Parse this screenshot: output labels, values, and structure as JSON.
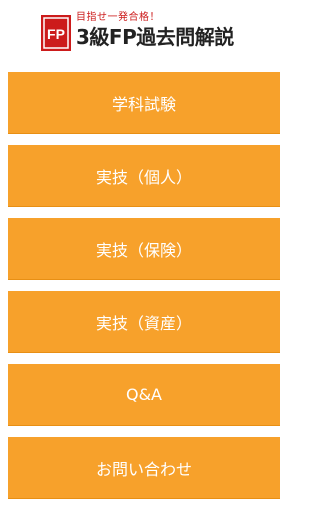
{
  "header": {
    "logo_text": "FP",
    "tagline": "目指せ一発合格！",
    "title": "3級FP過去問解説",
    "brand_color": "#cc1b1b"
  },
  "menu": {
    "accent_color": "#f7a12b",
    "items": [
      {
        "label": "学科試験"
      },
      {
        "label": "実技（個人）"
      },
      {
        "label": "実技（保険）"
      },
      {
        "label": "実技（資産）"
      },
      {
        "label": "Q&A"
      },
      {
        "label": "お問い合わせ"
      }
    ]
  }
}
